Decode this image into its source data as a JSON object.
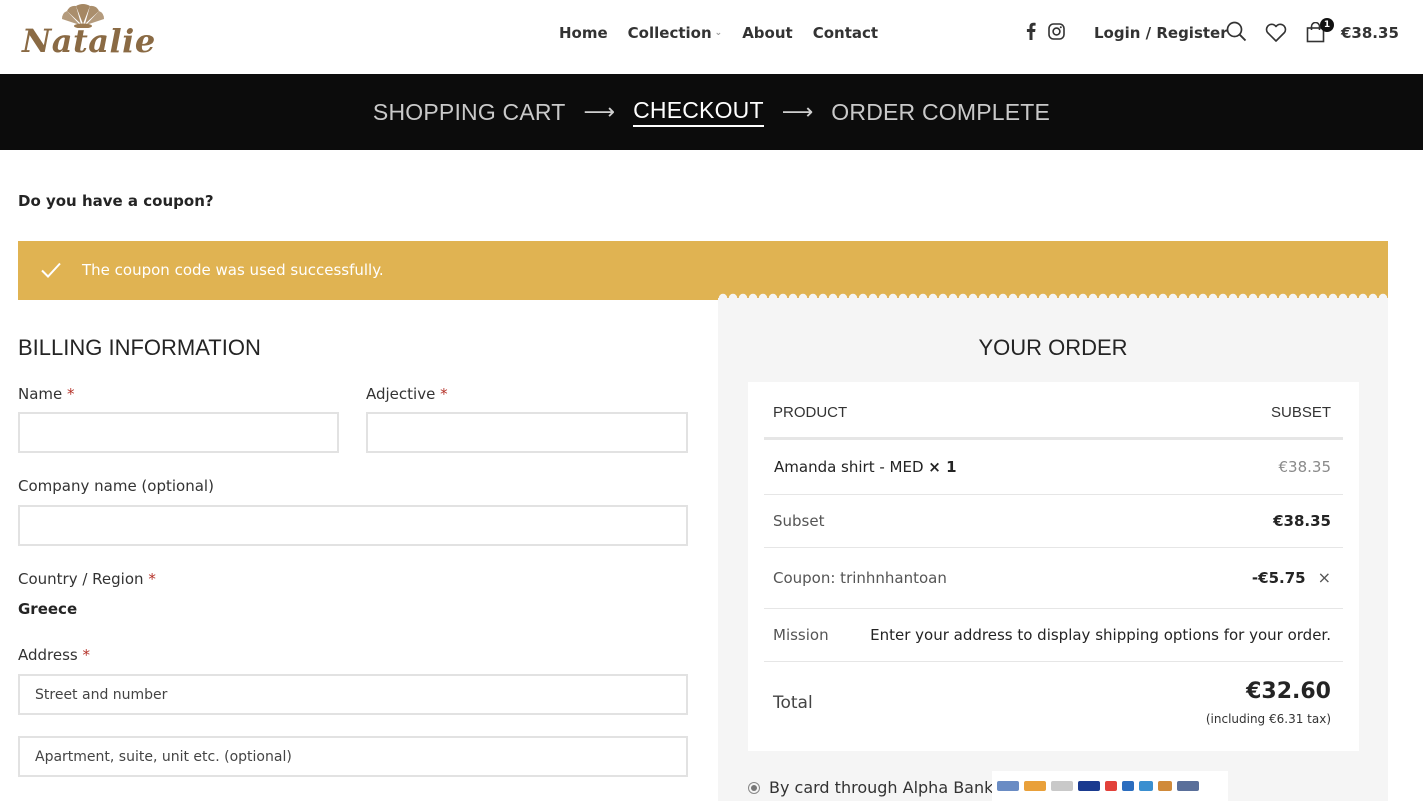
{
  "brand": {
    "logo_text": "Natalie"
  },
  "nav": {
    "items": [
      {
        "label": "Home"
      },
      {
        "label": "Collection",
        "has_dropdown": true
      },
      {
        "label": "About"
      },
      {
        "label": "Contact"
      }
    ],
    "login_label": "Login / Register",
    "cart_count": "1",
    "cart_total": "€38.35"
  },
  "steps": [
    {
      "label": "SHOPPING CART",
      "active": false
    },
    {
      "label": "CHECKOUT",
      "active": true
    },
    {
      "label": "ORDER COMPLETE",
      "active": false
    }
  ],
  "coupon": {
    "question": "Do you have a coupon?",
    "notice": "The coupon code was used successfully."
  },
  "billing": {
    "title": "BILLING INFORMATION",
    "name_label": "Name",
    "adjective_label": "Adjective",
    "company_label": "Company name (optional)",
    "country_label": "Country / Region",
    "country_value": "Greece",
    "address_label": "Address",
    "address_placeholder": "Street and number",
    "address2_placeholder": "Apartment, suite, unit etc. (optional)",
    "required_mark": "*"
  },
  "order": {
    "title": "YOUR ORDER",
    "col_product": "PRODUCT",
    "col_subset": "SUBSET",
    "item_name": "Amanda shirt - MED",
    "item_qty": "× 1",
    "item_price": "€38.35",
    "subset_label": "Subset",
    "subset_value": "€38.35",
    "coupon_label": "Coupon: trinhnhantoan",
    "coupon_value": "-€5.75",
    "remove_symbol": "×",
    "mission_label": "Mission",
    "mission_value": "Enter your address to display shipping options for your order.",
    "total_label": "Total",
    "total_value": "€32.60",
    "tax_note": "(including €6.31 tax)"
  },
  "payment": {
    "method_label": "By card through Alpha Bank"
  },
  "colors": {
    "accent": "#e0b352",
    "dark_bar": "#0c0c0c",
    "panel": "#f5f5f5",
    "required": "#b5332a"
  }
}
